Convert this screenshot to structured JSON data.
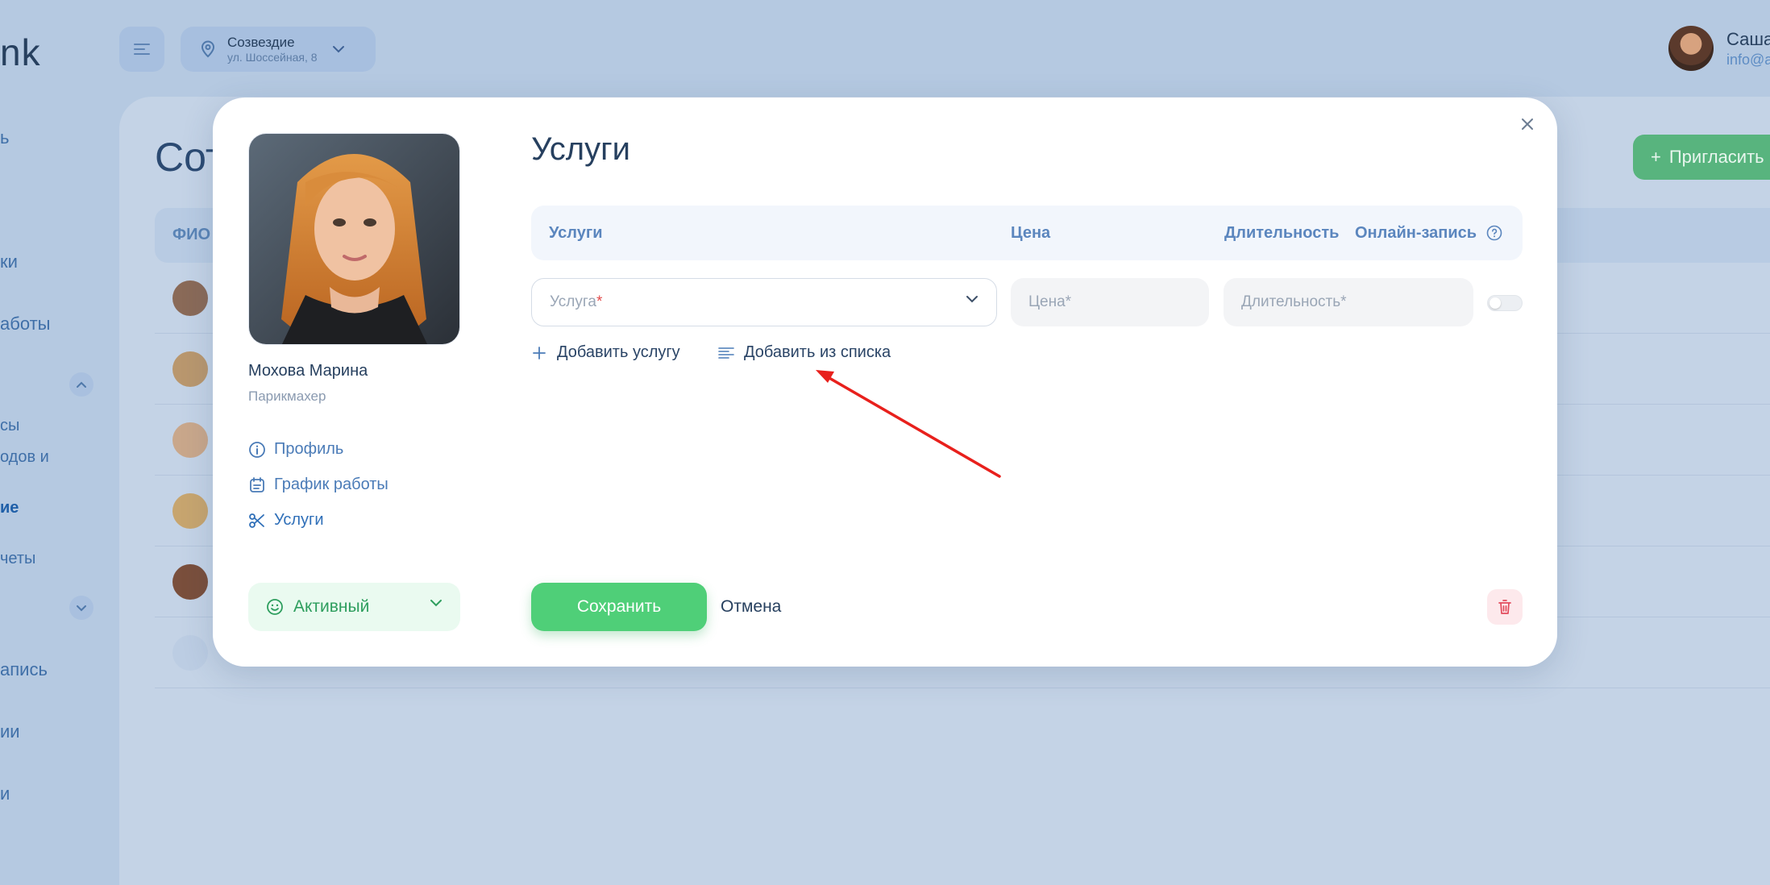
{
  "background": {
    "logo": "nk",
    "location": {
      "name": "Созвездие",
      "address": "ул. Шоссейная, 8"
    },
    "user": {
      "name": "Саша",
      "email": "info@a"
    },
    "sidebar": [
      "ь",
      "ки",
      "аботы",
      "сы",
      "одов и",
      "ие",
      "четы",
      "апись",
      "ии",
      "и"
    ],
    "page_title": "Сот",
    "invite_label": "Пригласить",
    "table_header": "ФИО"
  },
  "modal": {
    "employee": {
      "name": "Мохова Марина",
      "role": "Парикмахер"
    },
    "nav": [
      "Профиль",
      "График работы",
      "Услуги"
    ],
    "status": "Активный",
    "section_title": "Услуги",
    "columns": {
      "service": "Услуги",
      "price": "Цена",
      "duration": "Длительность",
      "online": "Онлайн-запись"
    },
    "fields": {
      "service_placeholder": "Услуга",
      "required_mark": "*",
      "price_placeholder": "Цена*",
      "duration_placeholder": "Длительность*"
    },
    "actions": {
      "add_service": "Добавить услугу",
      "add_from_list": "Добавить из списка",
      "save": "Сохранить",
      "cancel": "Отмена"
    }
  },
  "colors": {
    "accent_green": "#4fcf78",
    "accent_blue": "#4a7bb7",
    "danger": "#e24b5c",
    "annotation_arrow": "#e8201c"
  }
}
